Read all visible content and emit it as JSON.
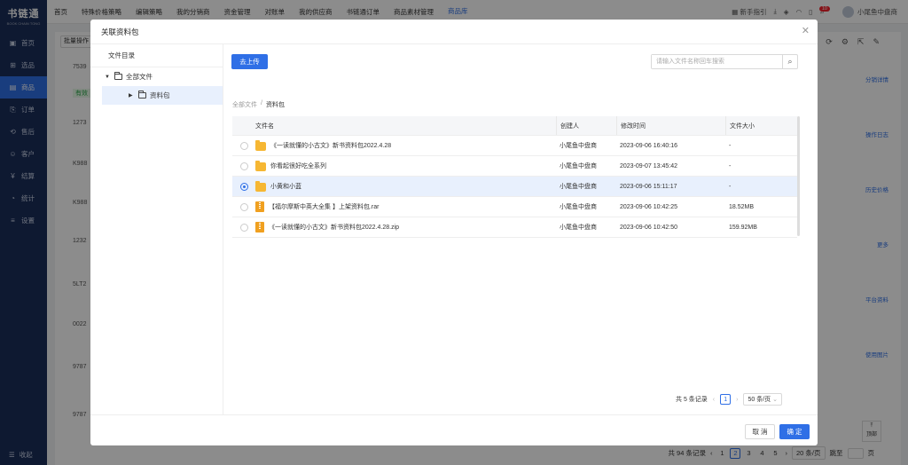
{
  "app": {
    "brand": "书链通",
    "brand_sub": "BOOK CHAIN TONG"
  },
  "sidebar": {
    "items": [
      {
        "label": "首页",
        "icon": "▣"
      },
      {
        "label": "选品",
        "icon": "⊞"
      },
      {
        "label": "商品",
        "icon": "▤"
      },
      {
        "label": "订单",
        "icon": "⎘"
      },
      {
        "label": "售后",
        "icon": "⟲"
      },
      {
        "label": "客户",
        "icon": "☺"
      },
      {
        "label": "结算",
        "icon": "¥"
      },
      {
        "label": "统计",
        "icon": "◔"
      },
      {
        "label": "设置",
        "icon": "≡"
      }
    ],
    "collapse_label": "收起"
  },
  "topnav": {
    "items": [
      "首页",
      "特殊价格策略",
      "编辑策略",
      "我的分销商",
      "资金管理",
      "对账单",
      "我的供应商",
      "书链通订单",
      "商品素材管理",
      "商品库"
    ],
    "guide": "新手指引",
    "notice_count": "10",
    "user": "小尾鱼中盘商"
  },
  "background": {
    "batch_label": "批量操作",
    "row_codes": [
      "7539",
      "1273",
      "K988",
      "K988",
      "1232",
      "5LT2",
      "0022",
      "9787",
      "9787"
    ],
    "row_tag": "有效",
    "links": [
      "分销详情",
      "操作日志",
      "历史价格",
      "更多",
      "平台资料",
      "使用图片"
    ],
    "pager": {
      "total": "共 94 条记录",
      "pages": [
        "1",
        "2",
        "3",
        "4",
        "5"
      ],
      "current": "2",
      "size": "20 条/页",
      "jump": "跳至",
      "page_unit": "页"
    },
    "to_top": "顶部"
  },
  "modal": {
    "title": "关联资料包",
    "tree_title": "文件目录",
    "tree_root": "全部文件",
    "tree_child": "资料包",
    "upload_label": "去上传",
    "search_placeholder": "请输入文件名称回车搜索",
    "breadcrumb": {
      "root": "全部文件",
      "sep": "/",
      "current": "资料包"
    },
    "columns": {
      "name": "文件名",
      "creator": "创建人",
      "time": "修改时间",
      "size": "文件大小"
    },
    "rows": [
      {
        "name": "《一读就懂的小古文》新书资料包2022.4.28",
        "type": "folder",
        "creator": "小尾鱼中盘商",
        "time": "2023-09-06 16:40:16",
        "size": "-",
        "selected": false
      },
      {
        "name": "你看起很好吃全系列",
        "type": "folder",
        "creator": "小尾鱼中盘商",
        "time": "2023-09-07 13:45:42",
        "size": "-",
        "selected": false
      },
      {
        "name": "小黄和小蓝",
        "type": "folder",
        "creator": "小尾鱼中盘商",
        "time": "2023-09-06 15:11:17",
        "size": "-",
        "selected": true
      },
      {
        "name": "【福尔摩斯中英大全集 】上架资料包.rar",
        "type": "zip",
        "creator": "小尾鱼中盘商",
        "time": "2023-09-06 10:42:25",
        "size": "18.52MB",
        "selected": false
      },
      {
        "name": "《一读就懂的小古文》新书资料包2022.4.28.zip",
        "type": "zip",
        "creator": "小尾鱼中盘商",
        "time": "2023-09-06 10:42:50",
        "size": "159.92MB",
        "selected": false
      }
    ],
    "pager": {
      "total": "共 5 条记录",
      "page": "1",
      "size": "50 条/页"
    },
    "cancel_label": "取 消",
    "ok_label": "确 定"
  },
  "colors": {
    "accent": "#2f6fe6",
    "sidebar": "#1a2e5a",
    "folder": "#f6b733"
  }
}
